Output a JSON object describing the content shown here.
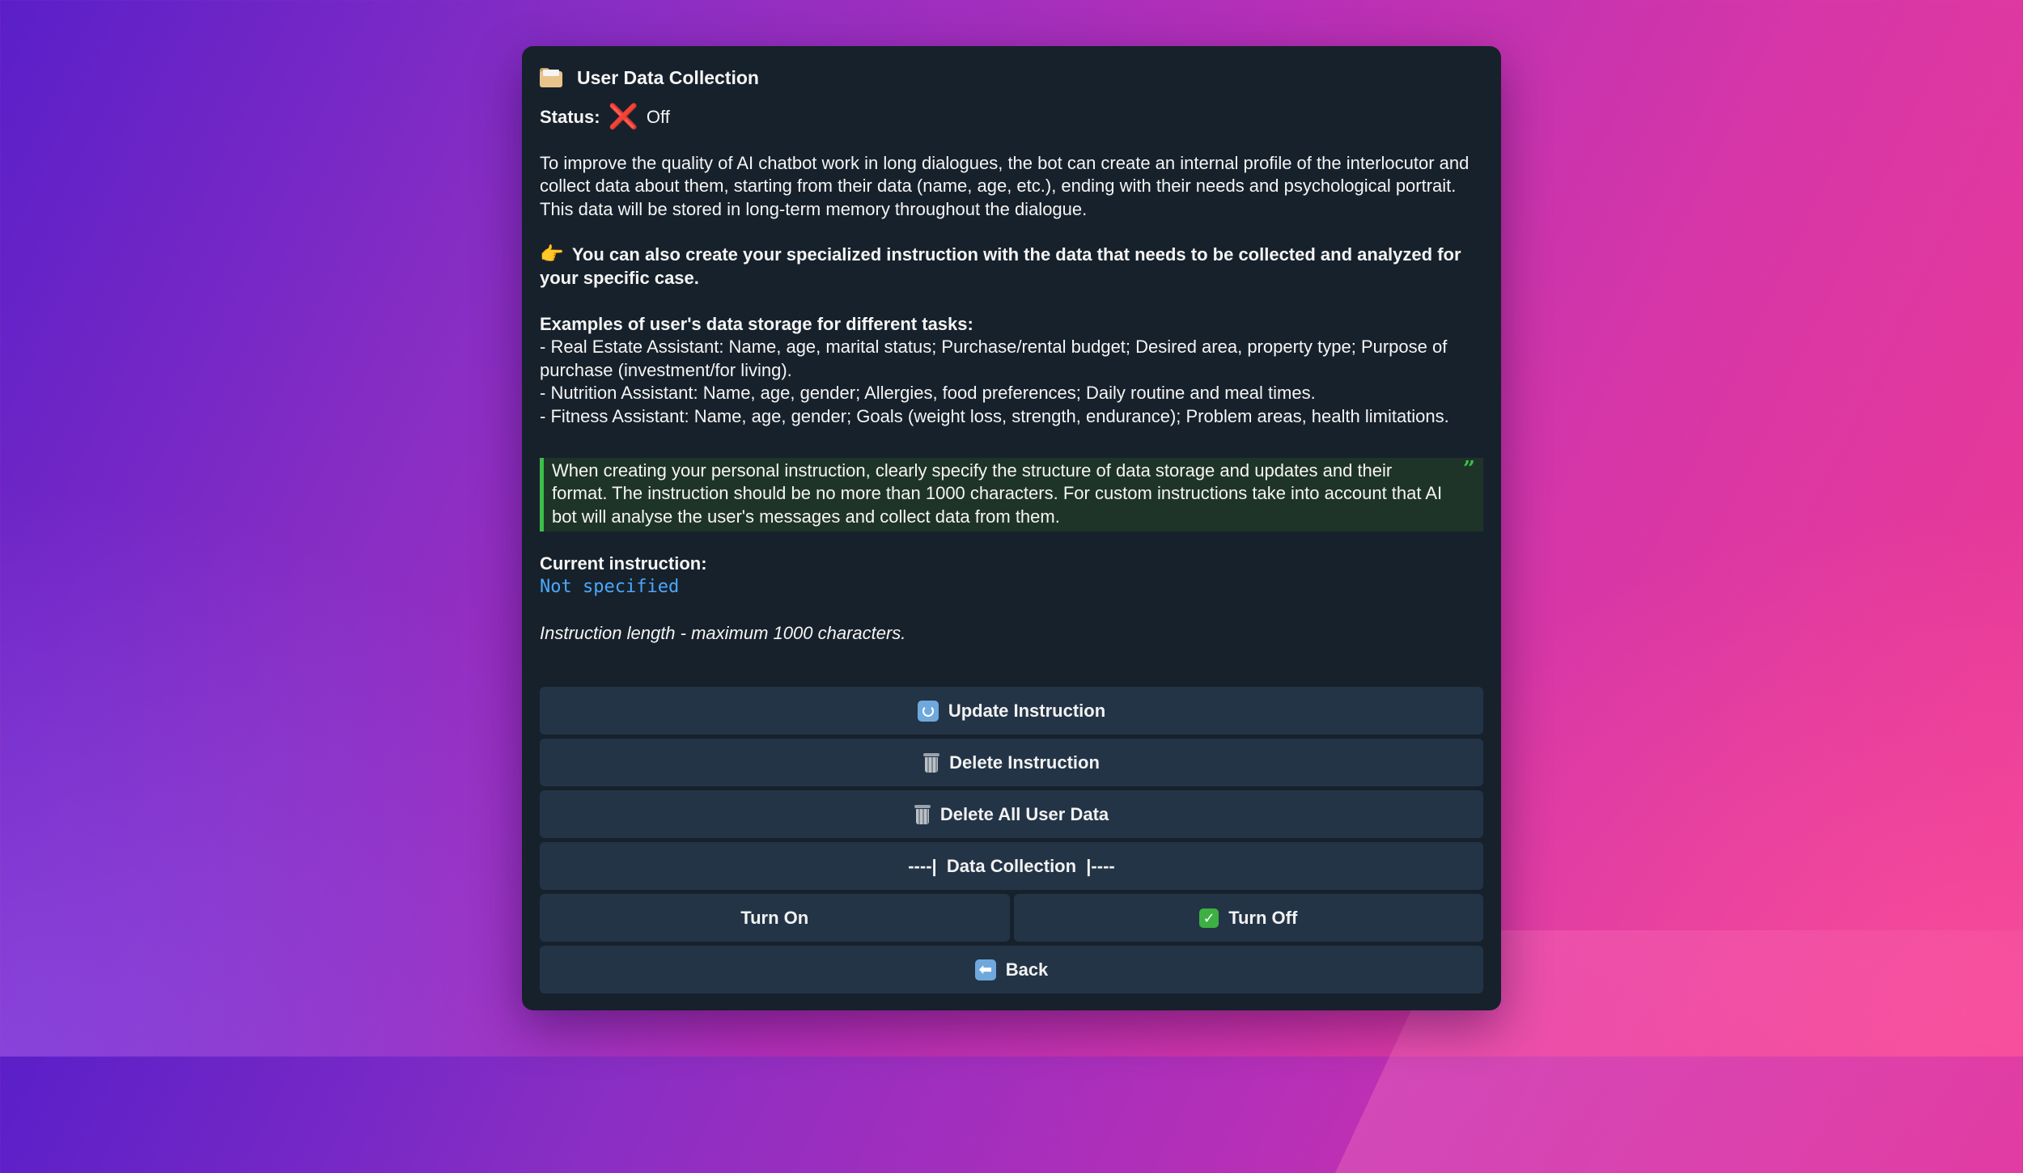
{
  "window": {
    "title": "User Data Collection",
    "title_icon": "folder-icon"
  },
  "status": {
    "label": "Status:",
    "icon": "cross-mark-icon",
    "icon_glyph": "❌",
    "value": "Off",
    "icon_color": "#e0242b"
  },
  "intro": "To improve the quality of AI chatbot work in long dialogues, the bot can create an internal profile of the interlocutor and collect data about them, starting from their data (name, age, etc.), ending with their needs and psychological portrait. This data will be stored in long-term memory throughout the dialogue.",
  "tip": {
    "icon": "pointing-hand-icon",
    "icon_glyph": "👉",
    "text": "You can also create your specialized instruction with the data that needs to be collected and analyzed for your specific case."
  },
  "examples": {
    "heading": "Examples of user's data storage for different tasks:",
    "items": [
      "- Real Estate Assistant: Name, age, marital status; Purchase/rental budget; Desired area, property type; Purpose of purchase (investment/for living).",
      "- Nutrition Assistant: Name, age, gender; Allergies, food preferences; Daily routine and meal times.",
      "- Fitness Assistant: Name, age, gender; Goals (weight loss, strength, endurance); Problem areas, health limitations."
    ]
  },
  "quote": {
    "text": "When creating your personal instruction, clearly specify the structure of data storage and updates and their format. The instruction should be no more than 1000 characters. For custom instructions take into account that AI bot will analyse the user's messages and collect data from them.",
    "accent_color": "#3cbf4a"
  },
  "current_instruction": {
    "label": "Current instruction:",
    "value": "Not specified",
    "value_color": "#4aa8ff"
  },
  "length_note": "Instruction length - maximum 1000 characters.",
  "buttons": {
    "update": {
      "label": "Update Instruction",
      "icon": "refresh-icon"
    },
    "delete": {
      "label": "Delete Instruction",
      "icon": "trash-icon"
    },
    "delete_all": {
      "label": "Delete All User Data",
      "icon": "trash-icon"
    },
    "section": {
      "label": "----|  Data Collection  |----"
    },
    "turn_on": {
      "label": "Turn On"
    },
    "turn_off": {
      "label": "Turn Off",
      "icon": "check-mark-icon",
      "icon_glyph": "✓"
    },
    "back": {
      "label": "Back",
      "icon": "back-arrow-icon",
      "icon_glyph": "⬅"
    }
  },
  "colors": {
    "panel_bg": "#17212b",
    "button_bg": "#233447"
  }
}
